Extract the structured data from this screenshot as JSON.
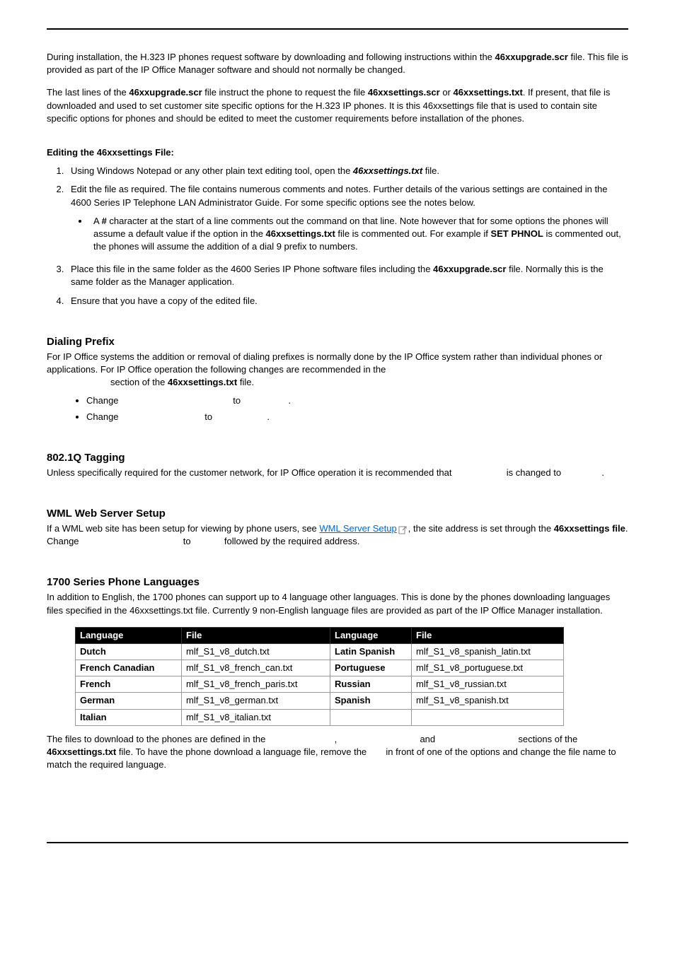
{
  "para1": {
    "t1": "During installation, the H.323 IP phones request software by downloading and following instructions within the ",
    "b1": "46xxupgrade.scr",
    "t2": " file. This file is provided as part of the IP Office Manager software and should not normally be changed."
  },
  "para2": {
    "t1": "The last lines of the ",
    "b1": "46xxupgrade.scr",
    "t2": " file instruct the phone to request the file ",
    "b2": "46xxsettings.scr",
    "t3": " or ",
    "b3": "46xxsettings.txt",
    "t4": ". If present, that file is downloaded and used to set customer site specific options for the H.323 IP phones. It is this 46xxsettings file that is used to contain site specific options for phones and should be edited to meet the customer requirements before installation of the phones."
  },
  "editHeading": "Editing the 46xxsettings File:",
  "step1": {
    "t1": "Using Windows Notepad or any other plain text editing tool, open the ",
    "b1": "46xxsettings.txt",
    "t2": " file."
  },
  "step2": "Edit the file as required. The file contains numerous comments and notes. Further details of the various settings are contained in the 4600 Series IP Telephone LAN Administrator Guide. For some specific options see the notes below.",
  "step2bullet": {
    "t1": "A ",
    "b1": "#",
    "t2": " character at the start of a line comments out the command on that line. Note however that for some options the phones will assume a default value if the option in the ",
    "b2": "46xxsettings.txt",
    "t3": " file is commented out. For example if ",
    "b3": "SET PHNOL",
    "t4": " is commented out, the phones will assume the addition of a dial 9 prefix to numbers."
  },
  "step3": {
    "t1": "Place this file in the same folder as the 4600 Series IP Phone software files including the ",
    "b1": "46xxupgrade.scr",
    "t2": " file. Normally this is the same folder as the Manager application."
  },
  "step4": "Ensure that you have a copy of the edited file.",
  "dialing": {
    "heading": "Dialing Prefix",
    "text1": "For IP Office systems the addition or removal of dialing prefixes is normally done by the IP Office system rather than individual phones or applications. For IP Office operation the following changes are recommended in the",
    "text2a": "section of the ",
    "text2b": "46xxsettings.txt",
    "text2c": " file.",
    "b1a": "Change",
    "b1b": "to",
    "b1c": ".",
    "b2a": "Change",
    "b2b": "to",
    "b2c": "."
  },
  "tagging": {
    "heading": "802.1Q Tagging",
    "text1": "Unless specifically required for the customer network, for IP Office operation it is recommended that",
    "text2": "is changed to",
    "text3": "."
  },
  "wml": {
    "heading": "WML Web Server Setup",
    "t1": "If a WML web site has been setup for viewing by phone users, see ",
    "link": "WML Server Setup",
    "t2": ", the site address is set through the ",
    "b1": "46xxsettings file",
    "t3": ". Change",
    "t4": "to",
    "t5": "followed by the required address."
  },
  "langSection": {
    "heading": "1700 Series Phone Languages",
    "intro": "In addition to English, the 1700 phones can support up to 4 language other languages. This is done by the phones downloading languages files specified in the 46xxsettings.txt file. Currently 9 non-English language files are provided as part of the IP Office Manager installation.",
    "headers": [
      "Language",
      "File",
      "Language",
      "File"
    ],
    "rows": [
      [
        "Dutch",
        "mlf_S1_v8_dutch.txt",
        "Latin Spanish",
        "mlf_S1_v8_spanish_latin.txt"
      ],
      [
        "French Canadian",
        "mlf_S1_v8_french_can.txt",
        "Portuguese",
        "mlf_S1_v8_portuguese.txt"
      ],
      [
        "French",
        "mlf_S1_v8_french_paris.txt",
        "Russian",
        "mlf_S1_v8_russian.txt"
      ],
      [
        "German",
        "mlf_S1_v8_german.txt",
        "Spanish",
        "mlf_S1_v8_spanish.txt"
      ],
      [
        "Italian",
        "mlf_S1_v8_italian.txt",
        "",
        ""
      ]
    ],
    "after": {
      "t1": "The files to download to the phones are defined in the",
      "t2": ",",
      "t3": "and",
      "t4": "sections of the ",
      "b1": "46xxsettings.txt",
      "t5": " file. To have the phone download a language file, remove the",
      "t6": "in front of one of the options and change the file name to match the required language."
    }
  }
}
